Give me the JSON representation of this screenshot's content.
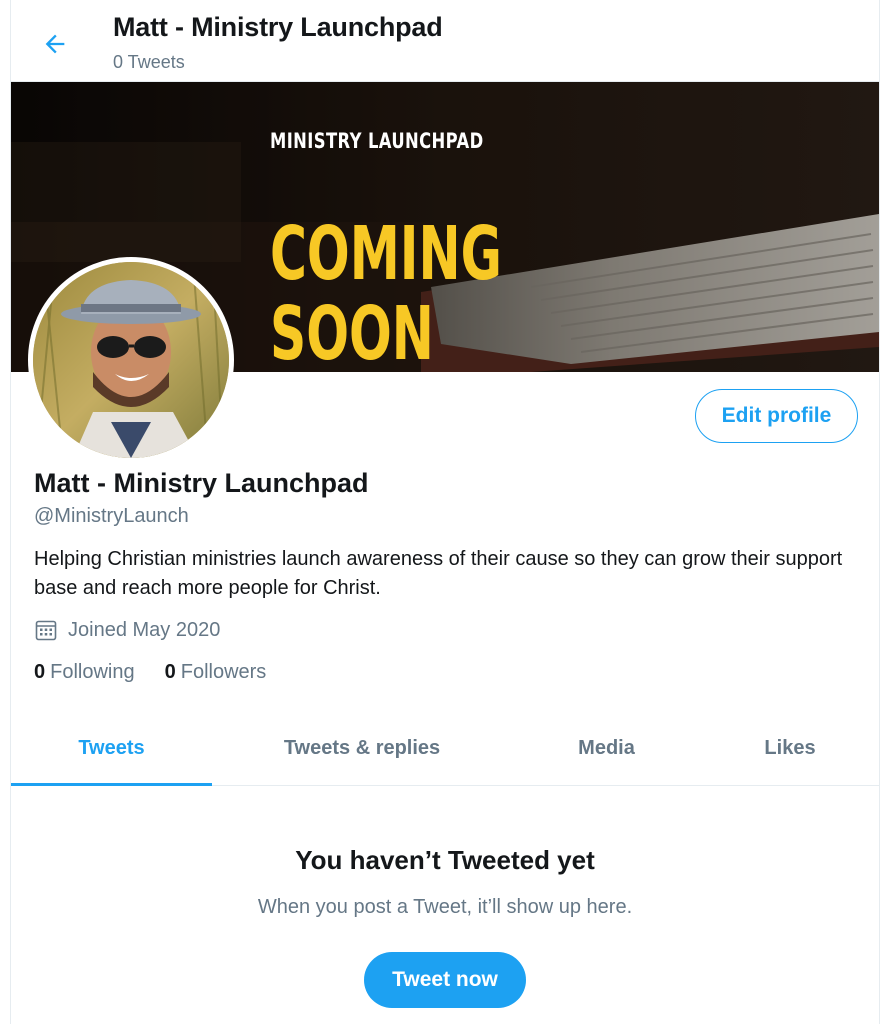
{
  "header": {
    "title": "Matt - Ministry Launchpad",
    "subtitle": "0 Tweets"
  },
  "banner": {
    "brand": "MINISTRY LAUNCHPAD",
    "headline_line1": "COMING",
    "headline_line2": "SOON"
  },
  "profile": {
    "name": "Matt - Ministry Launchpad",
    "handle": "@MinistryLaunch",
    "bio": "Helping Christian ministries launch awareness of their cause so they can grow their support base and reach more people for Christ.",
    "joined": "Joined May 2020",
    "edit_label": "Edit profile",
    "following_count": "0",
    "following_label": "Following",
    "followers_count": "0",
    "followers_label": "Followers"
  },
  "tabs": [
    {
      "label": "Tweets",
      "active": true
    },
    {
      "label": "Tweets & replies",
      "active": false
    },
    {
      "label": "Media",
      "active": false
    },
    {
      "label": "Likes",
      "active": false
    }
  ],
  "empty_state": {
    "title": "You haven’t Tweeted yet",
    "subtitle": "When you post a Tweet, it’ll show up here.",
    "button_label": "Tweet now"
  },
  "colors": {
    "accent": "#1da1f2",
    "secondary_text": "#657786",
    "banner_yellow": "#f7c825"
  },
  "icons": {
    "back": "arrow-left-icon",
    "joined": "calendar-icon"
  }
}
